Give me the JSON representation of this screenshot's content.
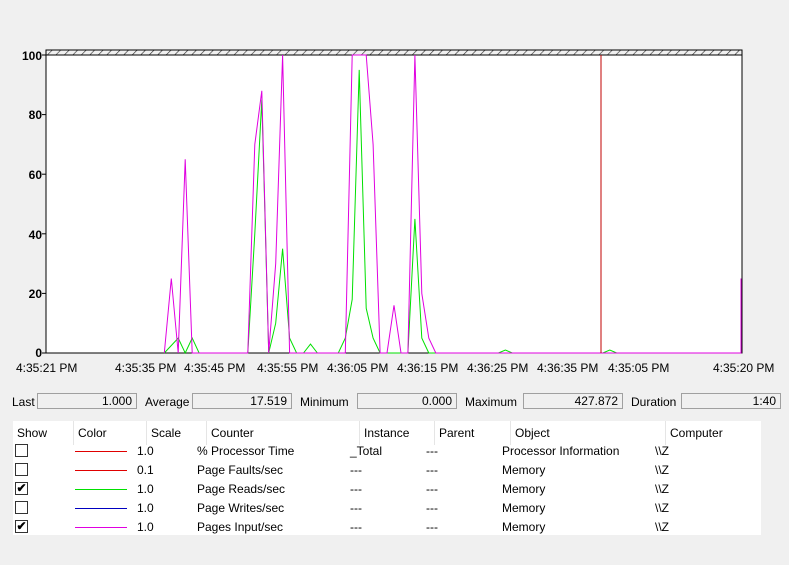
{
  "graph": {
    "y_ticks": [
      "100",
      "80",
      "60",
      "40",
      "20",
      "0"
    ],
    "x_ticks": [
      "4:35:21 PM",
      "4:35:35 PM",
      "4:35:45 PM",
      "4:35:55 PM",
      "4:36:05 PM",
      "4:36:15 PM",
      "4:36:25 PM",
      "4:36:35 PM",
      "4:35:05 PM",
      "4:35:20 PM"
    ]
  },
  "chart_data": {
    "type": "line",
    "ylim": [
      0,
      100
    ],
    "grid": false,
    "x_start_label": "4:35:21 PM",
    "x_end_label": "4:35:20 PM",
    "cursor_position_sample": 100,
    "sample_count": 101,
    "series": [
      {
        "name": "Page Reads/sec",
        "color": "#00e000",
        "points": [
          [
            17,
            0
          ],
          [
            19,
            5
          ],
          [
            20,
            0
          ],
          [
            21,
            5
          ],
          [
            22,
            0
          ],
          [
            23,
            0
          ],
          [
            24,
            0
          ],
          [
            25,
            0
          ],
          [
            26,
            0
          ],
          [
            27,
            0
          ],
          [
            28,
            0
          ],
          [
            29,
            0
          ],
          [
            30,
            40
          ],
          [
            31,
            85
          ],
          [
            32,
            0
          ],
          [
            33,
            10
          ],
          [
            34,
            35
          ],
          [
            35,
            5
          ],
          [
            36,
            0
          ],
          [
            37,
            0
          ],
          [
            38,
            3
          ],
          [
            39,
            0
          ],
          [
            40,
            0
          ],
          [
            41,
            0
          ],
          [
            42,
            0
          ],
          [
            43,
            5
          ],
          [
            44,
            18
          ],
          [
            45,
            95
          ],
          [
            46,
            15
          ],
          [
            47,
            5
          ],
          [
            48,
            0
          ],
          [
            49,
            0
          ],
          [
            50,
            0
          ],
          [
            51,
            0
          ],
          [
            52,
            0
          ],
          [
            53,
            45
          ],
          [
            54,
            5
          ],
          [
            55,
            0
          ],
          [
            56,
            0
          ],
          [
            65,
            0
          ],
          [
            66,
            1
          ],
          [
            67,
            0
          ],
          [
            80,
            0
          ],
          [
            81,
            1
          ],
          [
            82,
            0
          ],
          [
            100,
            0
          ],
          [
            101,
            5
          ],
          [
            102,
            0
          ],
          [
            103,
            1
          ],
          [
            104,
            0
          ]
        ]
      },
      {
        "name": "Pages Input/sec",
        "color": "#e000e0",
        "points": [
          [
            17,
            0
          ],
          [
            18,
            25
          ],
          [
            19,
            0
          ],
          [
            20,
            65
          ],
          [
            21,
            0
          ],
          [
            22,
            0
          ],
          [
            23,
            0
          ],
          [
            24,
            0
          ],
          [
            25,
            0
          ],
          [
            26,
            0
          ],
          [
            27,
            0
          ],
          [
            28,
            0
          ],
          [
            29,
            0
          ],
          [
            30,
            70
          ],
          [
            31,
            88
          ],
          [
            32,
            0
          ],
          [
            33,
            30
          ],
          [
            34,
            100
          ],
          [
            35,
            0
          ],
          [
            36,
            0
          ],
          [
            37,
            0
          ],
          [
            38,
            0
          ],
          [
            39,
            0
          ],
          [
            40,
            0
          ],
          [
            41,
            0
          ],
          [
            42,
            0
          ],
          [
            43,
            0
          ],
          [
            44,
            100
          ],
          [
            45,
            100
          ],
          [
            46,
            100
          ],
          [
            47,
            70
          ],
          [
            48,
            0
          ],
          [
            49,
            0
          ],
          [
            50,
            16
          ],
          [
            51,
            0
          ],
          [
            52,
            0
          ],
          [
            53,
            100
          ],
          [
            54,
            20
          ],
          [
            55,
            5
          ],
          [
            56,
            0
          ],
          [
            100,
            0
          ],
          [
            101,
            25
          ],
          [
            102,
            0
          ],
          [
            103,
            0
          ],
          [
            104,
            0
          ]
        ]
      }
    ]
  },
  "stats": {
    "last_label": "Last",
    "last_value": "1.000",
    "average_label": "Average",
    "average_value": "17.519",
    "minimum_label": "Minimum",
    "minimum_value": "0.000",
    "maximum_label": "Maximum",
    "maximum_value": "427.872",
    "duration_label": "Duration",
    "duration_value": "1:40"
  },
  "legend": {
    "headers": [
      "Show",
      "Color",
      "Scale",
      "Counter",
      "Instance",
      "Parent",
      "Object",
      "Computer"
    ],
    "rows": [
      {
        "checked": false,
        "check": "",
        "color": "#e00000",
        "scale": "1.0",
        "counter": "% Processor Time",
        "instance": "_Total",
        "parent": "---",
        "object": "Processor Information",
        "computer": "\\\\Z"
      },
      {
        "checked": false,
        "check": "",
        "color": "#e00000",
        "scale": "0.1",
        "counter": "Page Faults/sec",
        "instance": "---",
        "parent": "---",
        "object": "Memory",
        "computer": "\\\\Z"
      },
      {
        "checked": true,
        "check": "✔",
        "color": "#00e000",
        "scale": "1.0",
        "counter": "Page Reads/sec",
        "instance": "---",
        "parent": "---",
        "object": "Memory",
        "computer": "\\\\Z"
      },
      {
        "checked": false,
        "check": "",
        "color": "#0000c0",
        "scale": "1.0",
        "counter": "Page Writes/sec",
        "instance": "---",
        "parent": "---",
        "object": "Memory",
        "computer": "\\\\Z"
      },
      {
        "checked": true,
        "check": "✔",
        "color": "#e000e0",
        "scale": "1.0",
        "counter": "Pages Input/sec",
        "instance": "---",
        "parent": "---",
        "object": "Memory",
        "computer": "\\\\Z"
      }
    ]
  }
}
